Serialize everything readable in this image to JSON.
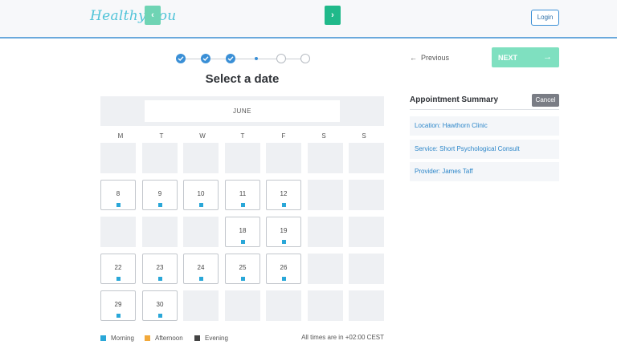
{
  "header": {
    "logo": "Healthy You",
    "login_label": "Login"
  },
  "page": {
    "title": "Select a date"
  },
  "calendar": {
    "month": "JUNE",
    "prev_icon": "‹",
    "next_icon": "›",
    "weekdays": [
      "M",
      "T",
      "W",
      "T",
      "F",
      "S",
      "S"
    ],
    "days": {
      "d8": "8",
      "d9": "9",
      "d10": "10",
      "d11": "11",
      "d12": "12",
      "d18": "18",
      "d19": "19",
      "d22": "22",
      "d23": "23",
      "d24": "24",
      "d25": "25",
      "d26": "26",
      "d29": "29",
      "d30": "30"
    }
  },
  "legend": {
    "morning": "Morning",
    "afternoon": "Afternoon",
    "evening": "Evening",
    "timezone": "All times are in +02:00 CEST",
    "colors": {
      "morning": "#2aa7d8",
      "afternoon": "#f2a93b",
      "evening": "#444444"
    }
  },
  "nav": {
    "previous_label": "Previous",
    "next_label": "NEXT"
  },
  "summary": {
    "title": "Appointment Summary",
    "cancel_label": "Cancel",
    "location": "Location: Hawthorn Clinic",
    "service": "Service: Short Psychological Consult",
    "provider": "Provider: James Taff"
  },
  "icons": {
    "back_arrow": "←",
    "forward_arrow": "→"
  }
}
